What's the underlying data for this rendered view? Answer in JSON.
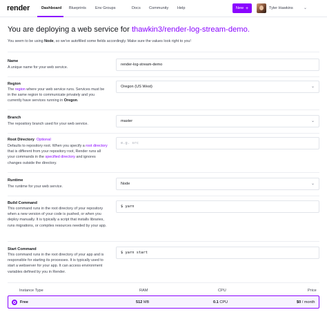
{
  "nav": {
    "logo": "render",
    "links": [
      "Dashboard",
      "Blueprints",
      "Env Groups",
      "Docs",
      "Community",
      "Help"
    ],
    "active": "Dashboard",
    "new_button": "New",
    "user_name": "Tyler Hawkins",
    "accent_color": "#8a05ff"
  },
  "headline": {
    "prefix": "You are deploying a web service for ",
    "repo": "thawkin3/render-log-stream-demo."
  },
  "subline": {
    "pre": "You seem to be using ",
    "lang": "Node",
    "post": ", so we've autofilled some fields accordingly. Make sure the values look right to you!"
  },
  "fields": {
    "name": {
      "label": "Name",
      "desc": "A unique name for your web service.",
      "value": "render-log-stream-demo"
    },
    "region": {
      "label": "Region",
      "desc_pre": "The ",
      "desc_link": "region",
      "desc_mid": " where your web service runs. Services must be in the same region to communicate privately and you currently have services running in ",
      "desc_bold": "Oregon",
      "desc_end": ".",
      "value": "Oregon (US West)"
    },
    "branch": {
      "label": "Branch",
      "desc": "The repository branch used for your web service.",
      "value": "master"
    },
    "root_directory": {
      "label": "Root Directory",
      "optional": "Optional",
      "desc_1": "Defaults to repository root. When you specify a ",
      "desc_link1": "root directory",
      "desc_2": " that is different from your repository root, Render runs all your commands in the ",
      "desc_link2": "specified directory",
      "desc_3": " and ignores changes outside the directory.",
      "placeholder": "e.g. src"
    },
    "runtime": {
      "label": "Runtime",
      "desc": "The runtime for your web service.",
      "value": "Node"
    },
    "build_command": {
      "label": "Build Command",
      "desc": "This command runs in the root directory of your repository when a new version of your code is pushed, or when you deploy manually. It is typically a script that installs libraries, runs migrations, or compiles resources needed by your app.",
      "value": "$ yarn"
    },
    "start_command": {
      "label": "Start Command",
      "desc": "This command runs in the root directory of your app and is responsible for starting its processes. It is typically used to start a webserver for your app. It can access environment variables defined by you in Render.",
      "value": "$ yarn start"
    }
  },
  "instance_table": {
    "headers": [
      "Instance Type",
      "RAM",
      "CPU",
      "Price"
    ],
    "row": {
      "type": "Free",
      "ram_value": "512",
      "ram_unit": " MB",
      "cpu_value": "0.1",
      "cpu_unit": " CPU",
      "price_value": "$0",
      "price_unit": " / month",
      "selected": true
    }
  }
}
